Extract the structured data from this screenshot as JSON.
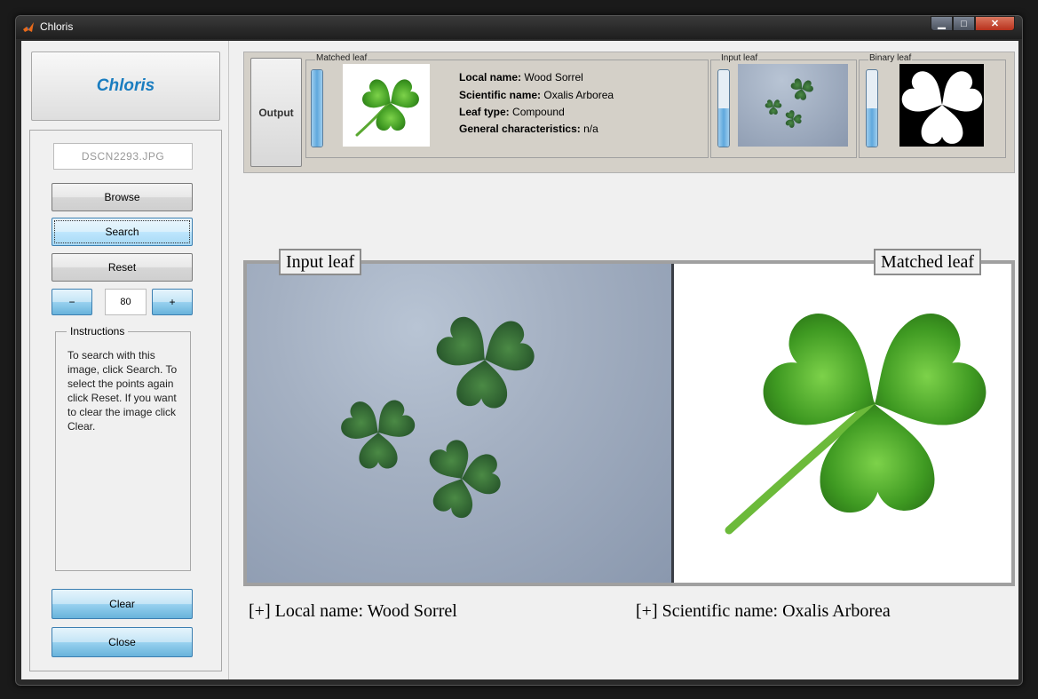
{
  "window": {
    "title": "Chloris",
    "minimize_symbol": "▁",
    "maximize_symbol": "□",
    "close_symbol": "✕"
  },
  "sidebar": {
    "logo": "Chloris",
    "file_name": "DSCN2293.JPG",
    "browse_label": "Browse",
    "search_label": "Search",
    "reset_label": "Reset",
    "decrement_label": "−",
    "increment_label": "+",
    "threshold_value": "80",
    "instructions_title": "Instructions",
    "instructions_text": "To search with this image, click Search. To select the points again click Reset. If you want to clear the image click Clear.",
    "clear_label": "Clear",
    "close_label": "Close"
  },
  "output": {
    "button_label": "Output",
    "matched_leaf": {
      "legend": "Matched leaf",
      "slider_level": 1.0,
      "local_name_label": "Local name:",
      "local_name": "Wood Sorrel",
      "scientific_name_label": "Scientific name:",
      "scientific_name": "Oxalis Arborea",
      "leaf_type_label": "Leaf type:",
      "leaf_type": "Compound",
      "general_label": "General characteristics:",
      "general": "n/a"
    },
    "input_leaf": {
      "legend": "Input leaf",
      "slider_level": 0.5
    },
    "binary_leaf": {
      "legend": "Binary leaf",
      "slider_level": 0.5
    }
  },
  "viewer": {
    "input_label": "Input leaf",
    "matched_label": "Matched leaf"
  },
  "captions": {
    "local": "[+] Local name: Wood Sorrel",
    "scientific": "[+] Scientific name: Oxalis Arborea"
  },
  "colors": {
    "leaf_green": "#3f9a22",
    "leaf_dark": "#2f6b2e",
    "accent_blue": "#1a7dc0"
  }
}
